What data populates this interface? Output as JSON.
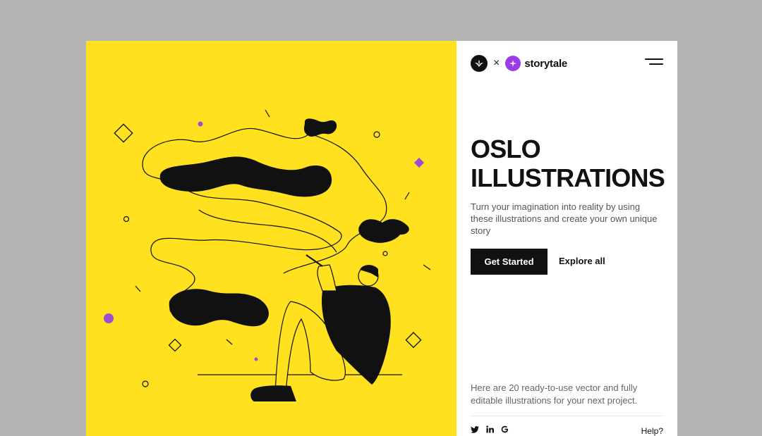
{
  "brand": {
    "separator": "×",
    "name": "storytale",
    "icons": {
      "left_logo": "leaf-logo-icon",
      "right_logo": "plus-logo-icon",
      "menu": "hamburger-menu-icon"
    }
  },
  "colors": {
    "page_background": "#b4b4b4",
    "hero_yellow": "#ffe120",
    "accent_purple": "#9b4fd0",
    "ink": "#111111"
  },
  "hero": {
    "title_line1": "OSLO",
    "title_line2": "ILLUSTRATIONS",
    "subtitle": "Turn your imagination into reality by using these illustrations and create your own unique story",
    "primary_cta": "Get Started",
    "secondary_cta": "Explore all"
  },
  "footnote": "Here are 20 ready-to-use vector and fully editable illustrations for your next project.",
  "footer": {
    "social_icons": [
      "twitter-icon",
      "linkedin-icon",
      "google-icon"
    ],
    "help_label": "Help?"
  },
  "illustration": {
    "subject": "person-sitting-drawing-abstract-shapes"
  }
}
